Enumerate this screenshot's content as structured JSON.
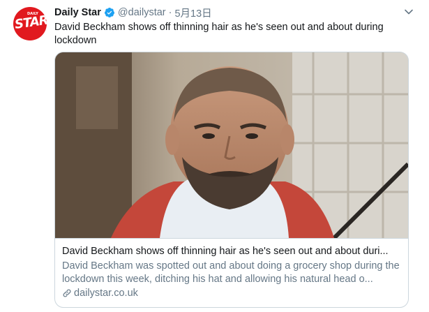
{
  "tweet": {
    "author": {
      "display_name": "Daily Star",
      "handle": "@dailystar",
      "verified": true,
      "avatar_text": "STAR",
      "avatar_small_text": "DAILY"
    },
    "separator": "·",
    "date": "5月13日",
    "text": "David Beckham shows off thinning hair as he's seen out and about during lockdown"
  },
  "card": {
    "title": "David Beckham shows off thinning hair as he's seen out and about duri...",
    "description": "David Beckham was spotted out and about doing a grocery shop during the lockdown this week, ditching his hat and allowing his natural head o...",
    "domain": "dailystar.co.uk"
  },
  "colors": {
    "brand_red": "#e1191f",
    "verified_blue": "#1da1f2",
    "secondary_text": "#657786",
    "border": "#ccd6dd"
  },
  "icons": {
    "verified": "verified-badge-icon",
    "menu": "chevron-down-icon",
    "link": "link-icon"
  }
}
